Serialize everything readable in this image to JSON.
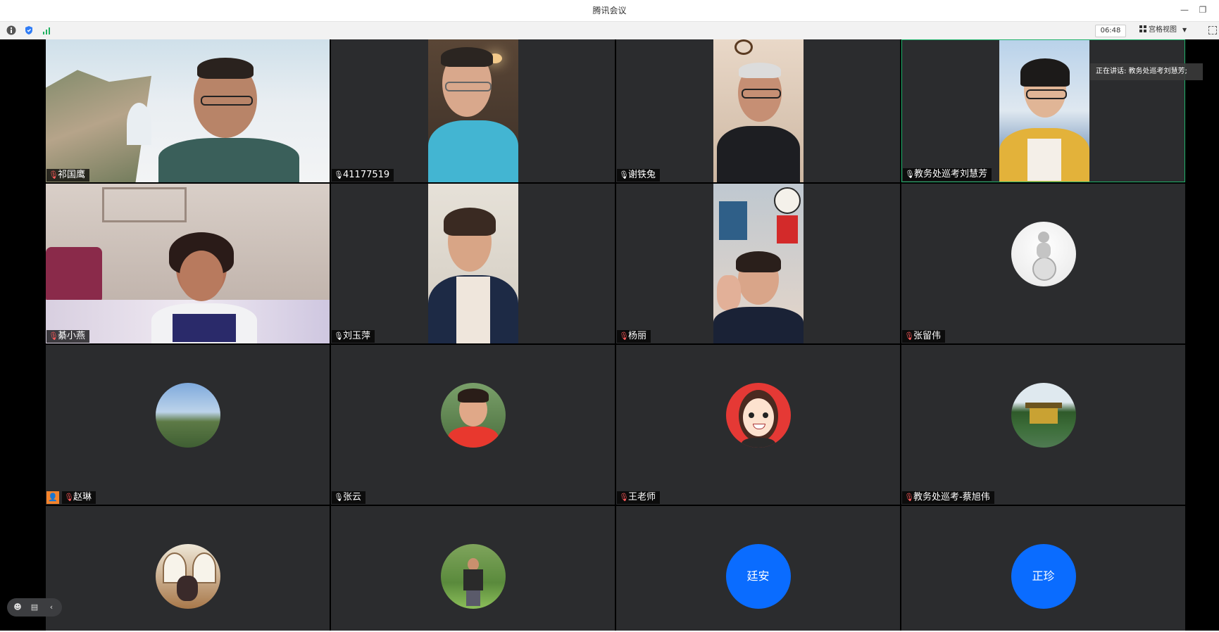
{
  "window": {
    "title": "腾讯会议",
    "minimize_icon": "minimize-icon",
    "restore_icon": "restore-icon"
  },
  "toolbar": {
    "timer": "06:48",
    "view_label": "宫格视图",
    "icons": [
      "info-icon",
      "shield-icon",
      "signal-icon"
    ]
  },
  "speaking": {
    "label": "正在讲话: 教务处巡考刘慧芳;"
  },
  "participants": [
    {
      "name": "祁国鹰",
      "mic": "muted"
    },
    {
      "name": "41177519",
      "mic": "on"
    },
    {
      "name": "谢铁兔",
      "mic": "on"
    },
    {
      "name": "教务处巡考刘慧芳",
      "mic": "on"
    },
    {
      "name": "綦小燕",
      "mic": "muted"
    },
    {
      "name": "刘玉萍",
      "mic": "on"
    },
    {
      "name": "杨丽",
      "mic": "muted"
    },
    {
      "name": "张留伟",
      "mic": "muted"
    },
    {
      "name": "赵琳",
      "mic": "muted"
    },
    {
      "name": "张云",
      "mic": "on"
    },
    {
      "name": "王老师",
      "mic": "muted"
    },
    {
      "name": "教务处巡考-蔡旭伟",
      "mic": "muted"
    },
    {
      "name": "",
      "mic": ""
    },
    {
      "name": "",
      "mic": ""
    },
    {
      "name": "",
      "mic": "",
      "avatar_text": "廷安"
    },
    {
      "name": "",
      "mic": "",
      "avatar_text": "正珍"
    }
  ],
  "colors": {
    "tile_bg": "#2b2c2e",
    "speaking_border": "#1fb36b",
    "avatar_blue": "#0a6cff",
    "host_badge": "#f5832b"
  }
}
